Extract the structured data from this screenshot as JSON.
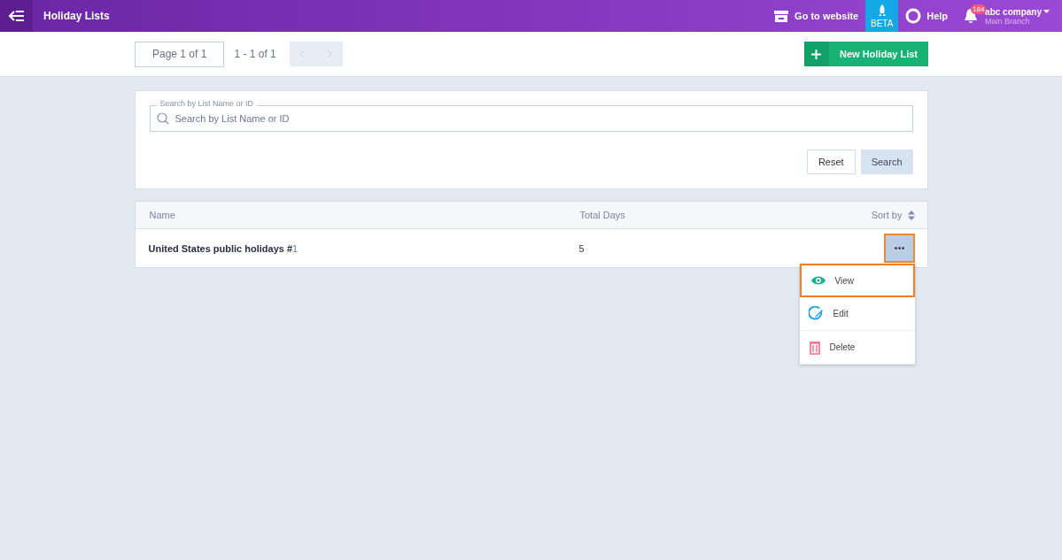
{
  "topbar": {
    "title": "Holiday Lists",
    "website_link": "Go to website",
    "beta_label": "BETA",
    "help_label": "Help",
    "notification_count": "184",
    "company": "abc company",
    "branch": "Main Branch"
  },
  "pager": {
    "page": "Page 1 of 1",
    "range": "1 - 1 of 1",
    "prev_disabled": true,
    "next_disabled": true
  },
  "new_button": "New Holiday List",
  "search": {
    "label": "Search by List Name or ID",
    "placeholder": "Search by List Name or ID",
    "reset": "Reset",
    "submit": "Search"
  },
  "table": {
    "columns": [
      "Name",
      "Total Days"
    ],
    "sort_label": "Sort by",
    "rows": [
      {
        "name": "United States public holidays #",
        "number": "1",
        "total_days": "5",
        "menu_open": true
      }
    ]
  },
  "row_menu": [
    {
      "kind": "view",
      "label": "View",
      "selected": true
    },
    {
      "kind": "edit",
      "label": "Edit",
      "selected": false
    },
    {
      "kind": "delete",
      "label": "Delete",
      "selected": false
    }
  ]
}
